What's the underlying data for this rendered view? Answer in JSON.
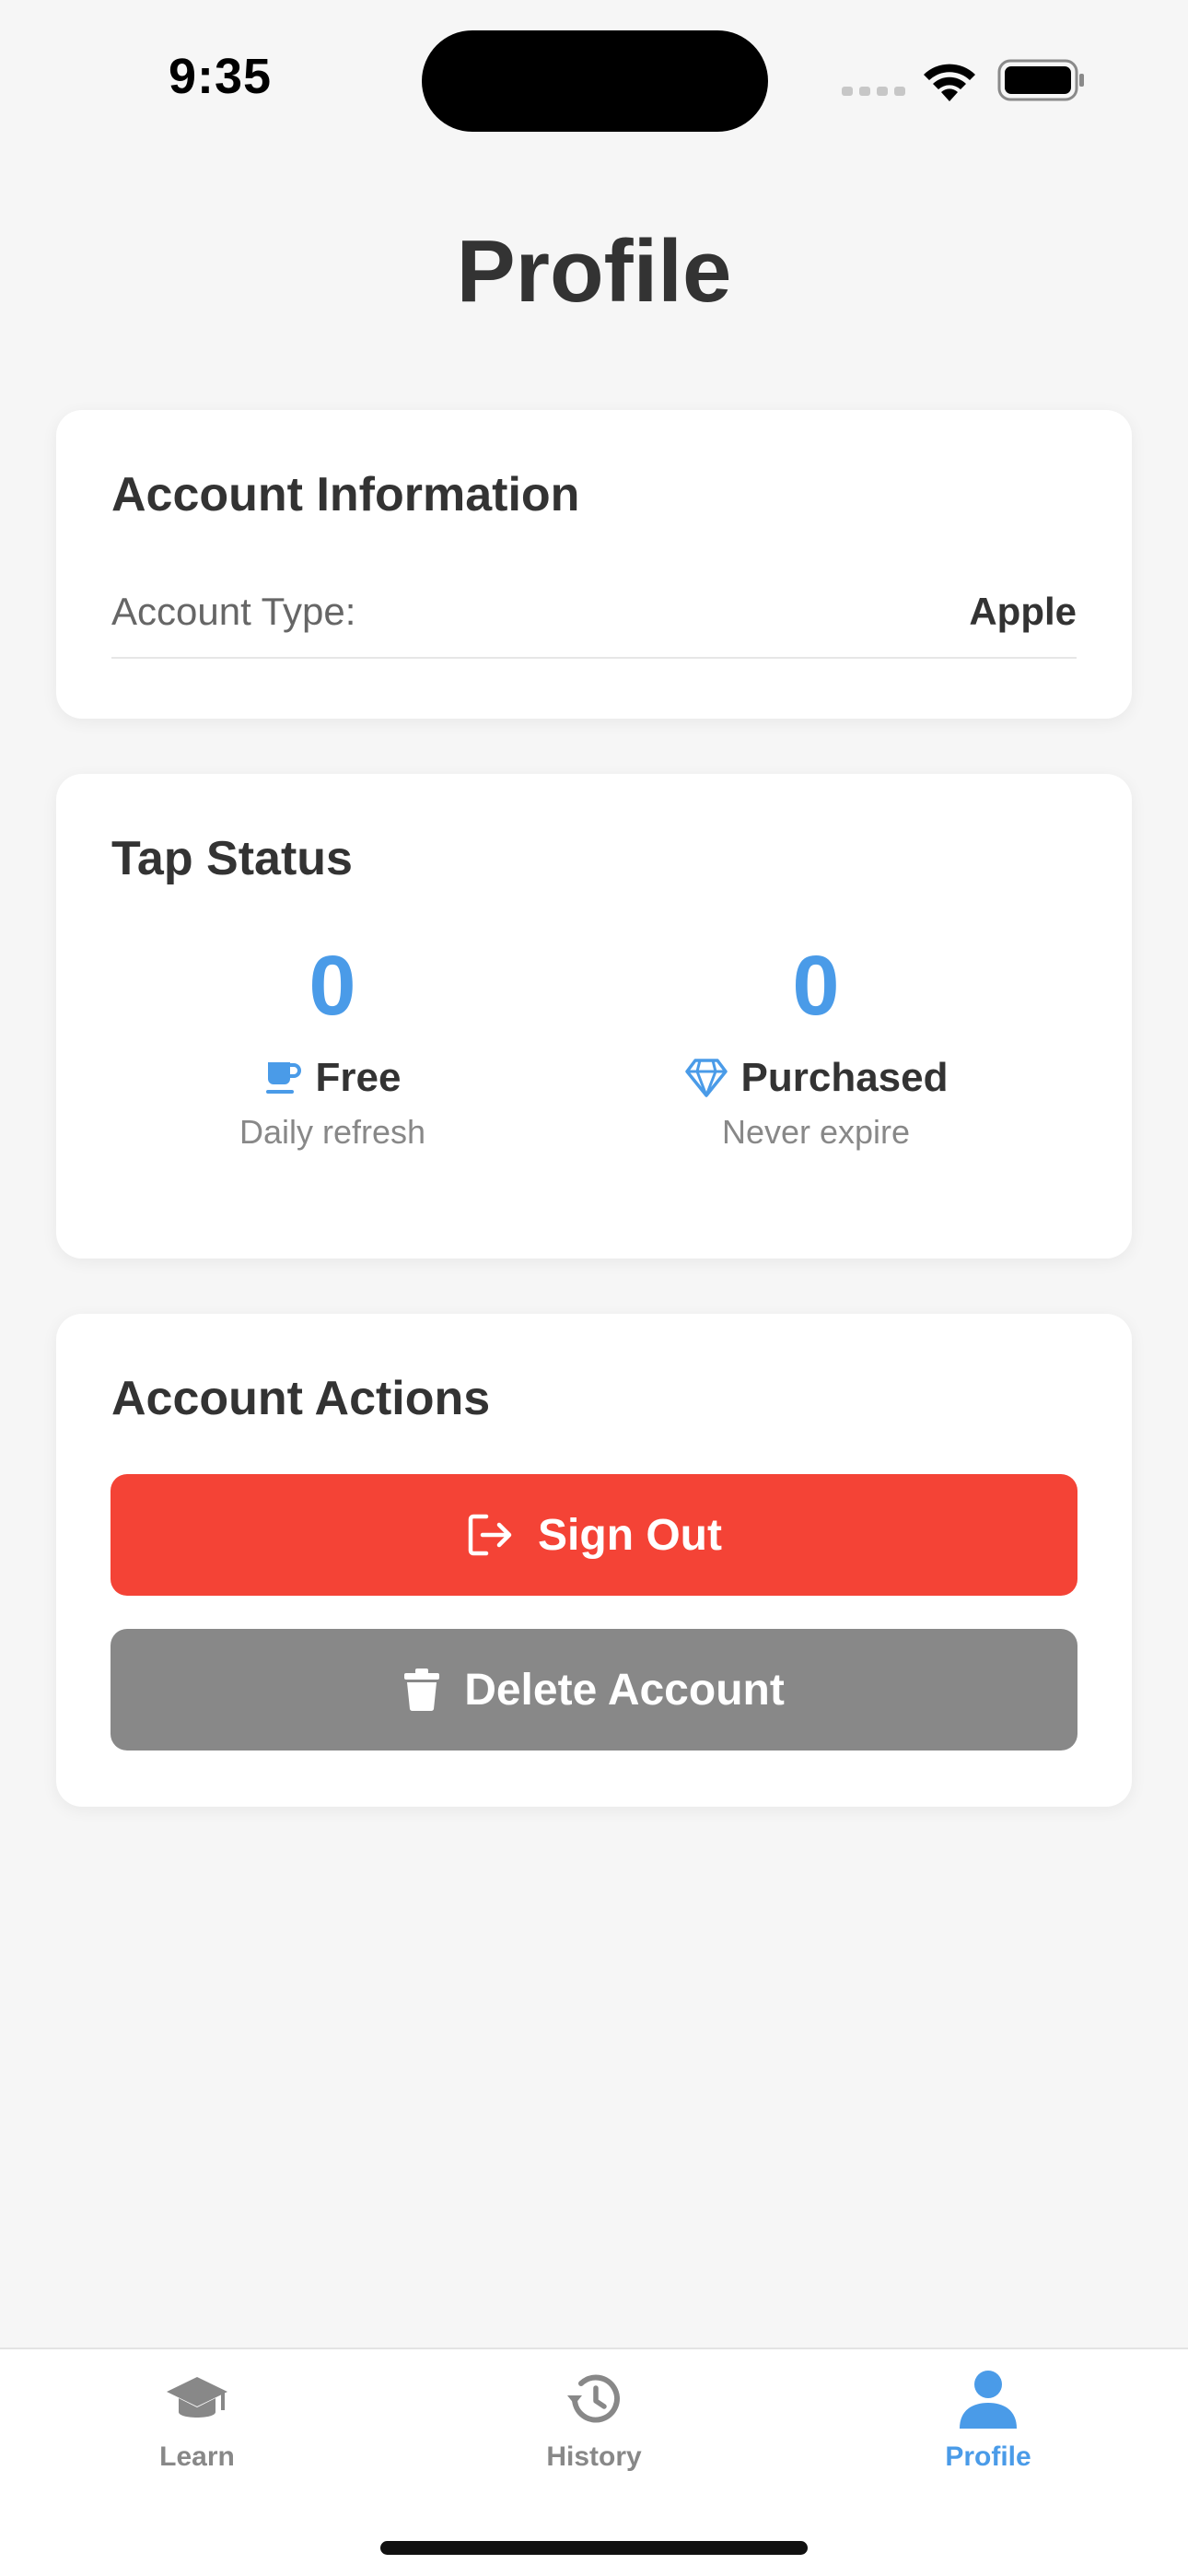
{
  "status_bar": {
    "time": "9:35"
  },
  "page": {
    "title": "Profile"
  },
  "account_info": {
    "title": "Account Information",
    "rows": [
      {
        "label": "Account Type:",
        "value": "Apple"
      }
    ]
  },
  "tap_status": {
    "title": "Tap Status",
    "free": {
      "count": "0",
      "label": "Free",
      "subtitle": "Daily refresh",
      "icon": "coffee-icon"
    },
    "purchased": {
      "count": "0",
      "label": "Purchased",
      "subtitle": "Never expire",
      "icon": "diamond-icon"
    }
  },
  "account_actions": {
    "title": "Account Actions",
    "sign_out": {
      "label": "Sign Out",
      "icon": "sign-out-icon",
      "color": "#f44336"
    },
    "delete": {
      "label": "Delete Account",
      "icon": "trash-icon",
      "color": "#888888"
    }
  },
  "tab_bar": {
    "active": "Profile",
    "active_color": "#4a9be8",
    "inactive_color": "#888888",
    "tabs": [
      {
        "label": "Learn",
        "icon": "graduation-cap-icon"
      },
      {
        "label": "History",
        "icon": "history-icon"
      },
      {
        "label": "Profile",
        "icon": "person-icon"
      }
    ]
  }
}
